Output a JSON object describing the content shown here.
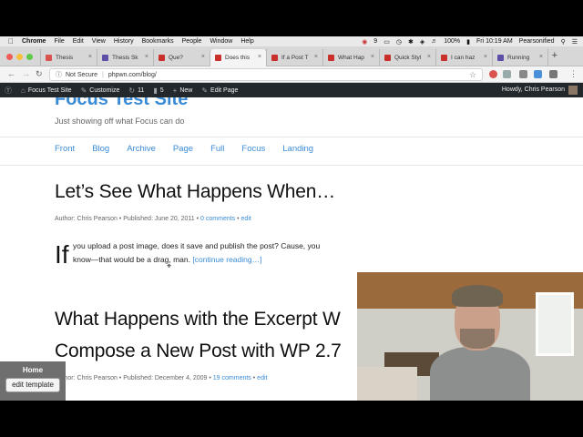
{
  "menubar": {
    "app": "Chrome",
    "items": [
      "File",
      "Edit",
      "View",
      "History",
      "Bookmarks",
      "People",
      "Window",
      "Help"
    ],
    "status_count": "9",
    "battery": "100%",
    "clock": "Fri 10:19 AM",
    "user": "Pearsonified"
  },
  "tabs": [
    {
      "label": "Thesis",
      "color": "#d9534f",
      "active": false
    },
    {
      "label": "Thesis Sk",
      "color": "#5b4fa8",
      "active": false
    },
    {
      "label": "Que?",
      "color": "#c9302c",
      "active": false
    },
    {
      "label": "Does this",
      "color": "#c9302c",
      "active": true
    },
    {
      "label": "If a Post T",
      "color": "#c9302c",
      "active": false
    },
    {
      "label": "What Hap",
      "color": "#c9302c",
      "active": false
    },
    {
      "label": "Quick Styl",
      "color": "#c9302c",
      "active": false
    },
    {
      "label": "I can haz",
      "color": "#c9302c",
      "active": false
    },
    {
      "label": "Running",
      "color": "#5b4fa8",
      "active": false
    }
  ],
  "address": {
    "security": "Not Secure",
    "url": "phpwn.com/blog/"
  },
  "adminbar": {
    "site": "Focus Test Site",
    "customize": "Customize",
    "updates": "11",
    "comments": "5",
    "new": "New",
    "edit_page": "Edit Page",
    "howdy": "Howdy, Chris Pearson"
  },
  "site": {
    "title": "Focus Test Site",
    "tagline": "Just showing off what Focus can do",
    "nav": [
      "Front",
      "Blog",
      "Archive",
      "Page",
      "Full",
      "Focus",
      "Landing"
    ]
  },
  "posts": [
    {
      "title": "Let’s See What Happens When…",
      "meta_prefix": "Author: Chris Pearson • Published: June 20, 2011 •",
      "comments": "0 comments",
      "edit": "edit",
      "dropcap": "If",
      "line1": "you upload a post image, does it save and publish the post? Cause, you",
      "line2": "know—that would be a drag, man.",
      "more": "[continue reading…]"
    },
    {
      "title_line1": "What Happens with the Excerpt W",
      "title_line2": "Compose a New Post with WP 2.7",
      "meta_prefix": "Author: Chris Pearson • Published: December 4, 2009 •",
      "comments": "19 comments",
      "edit": "edit"
    }
  ],
  "home_widget": {
    "label": "Home",
    "button": "edit template"
  }
}
